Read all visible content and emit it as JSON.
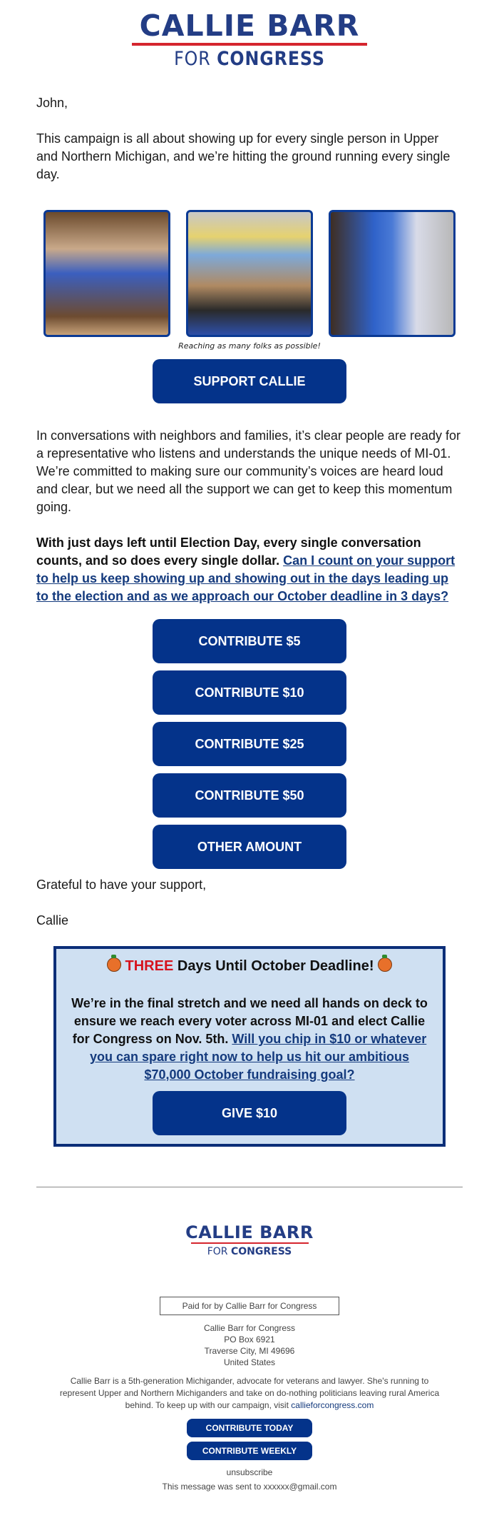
{
  "header": {
    "logo_name": "CALLIE BARR",
    "logo_sub_prefix": "FOR",
    "logo_sub_main": "CONGRESS"
  },
  "greeting": "John,",
  "intro": "This campaign is all about showing up for every single person in Upper and Northern Michigan, and we’re hitting the ground running every single day.",
  "photos": {
    "items": [
      {
        "alt": "Supporters with campaign mascot indoors"
      },
      {
        "alt": "Volunteers meeting in campaign office"
      },
      {
        "alt": "Mascot with supporter outdoors"
      }
    ],
    "caption": "Reaching as many folks as possible!"
  },
  "support_button": "SUPPORT CALLIE",
  "body_para": "In conversations with neighbors and families, it’s clear people are ready for a representative who listens and understands the unique needs of MI-01. We’re committed to making sure our community’s voices are heard loud and clear, but we need all the support we can get to keep this momentum going.",
  "ask": {
    "bold_text": "With just days left until Election Day, every single conversation counts, and so does every single dollar. ",
    "link_text": "Can I count on your support to help us keep showing up and showing out in the days leading up to the election and as we approach our October deadline in 3 days?"
  },
  "contribute_buttons": [
    "CONTRIBUTE $5",
    "CONTRIBUTE $10",
    "CONTRIBUTE $25",
    "CONTRIBUTE $50",
    "OTHER AMOUNT"
  ],
  "closing": "Grateful to have your support,",
  "signature": "Callie",
  "deadline_box": {
    "title_red": "THREE",
    "title_rest": " Days Until October Deadline! ",
    "icon": "jack-o-lantern",
    "body_bold": "We’re in the final stretch and we need all hands on deck to ensure we reach every voter across MI-01 and elect Callie for Congress on Nov. 5th. ",
    "body_link": "Will you chip in $10 or whatever you can spare right now to help us hit our ambitious $70,000 October fundraising goal?",
    "button": "GIVE $10"
  },
  "footer": {
    "logo_name": "CALLIE BARR",
    "logo_sub_prefix": "FOR",
    "logo_sub_main": "CONGRESS",
    "paid_for": "Paid for by Callie Barr for Congress",
    "address": [
      "Callie Barr for Congress",
      "PO Box 6921",
      "Traverse City, MI 49696",
      "United States"
    ],
    "bio": "Callie Barr is a 5th-generation Michigander, advocate for veterans and lawyer. She's running to represent Upper and Northern Michiganders and take on do-nothing politicians leaving rural America behind. To keep up with our campaign, visit ",
    "bio_link": "callieforcongress.com",
    "btn_today": "CONTRIBUTE TODAY",
    "btn_weekly": "CONTRIBUTE WEEKLY",
    "unsubscribe": "unsubscribe",
    "sent_to": "This message was sent to xxxxxx@gmail.com"
  },
  "colors": {
    "brand_blue": "#04338a",
    "logo_blue": "#233d85",
    "accent_red": "#d5252e",
    "box_bg": "#cfe0f2",
    "link": "#143a7d"
  }
}
